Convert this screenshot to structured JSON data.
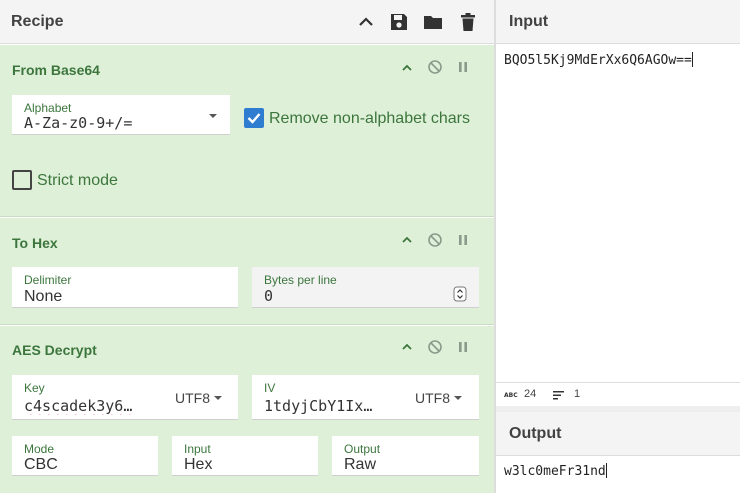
{
  "recipe": {
    "title": "Recipe"
  },
  "operations": {
    "from_base64": {
      "title": "From Base64",
      "alphabet_label": "Alphabet",
      "alphabet_value": "A-Za-z0-9+/=",
      "remove_label": "Remove non-alphabet chars",
      "remove_checked": true,
      "strict_label": "Strict mode",
      "strict_checked": false
    },
    "to_hex": {
      "title": "To Hex",
      "delimiter_label": "Delimiter",
      "delimiter_value": "None",
      "bpl_label": "Bytes per line",
      "bpl_value": "0"
    },
    "aes_decrypt": {
      "title": "AES Decrypt",
      "key_label": "Key",
      "key_value": "c4scadek3y6…",
      "key_encoding": "UTF8",
      "iv_label": "IV",
      "iv_value": "1tdyjCbY1Ix…",
      "iv_encoding": "UTF8",
      "mode_label": "Mode",
      "mode_value": "CBC",
      "input_label": "Input",
      "input_value": "Hex",
      "output_label": "Output",
      "output_value": "Raw"
    }
  },
  "input": {
    "title": "Input",
    "text": "BQO5l5Kj9MdErXx6Q6AGOw==",
    "length": "24",
    "lines": "1"
  },
  "output": {
    "title": "Output",
    "text": "w3lc0meFr31nd"
  },
  "colors": {
    "op_bg": "#dff0d8",
    "op_title": "#3c763d",
    "check_on": "#2f7dd1"
  },
  "icons": {
    "header": [
      "chevron-up-icon",
      "save-icon",
      "folder-icon",
      "trash-icon"
    ],
    "op_controls": [
      "chevron-up-icon",
      "disable-icon",
      "pause-icon"
    ]
  }
}
